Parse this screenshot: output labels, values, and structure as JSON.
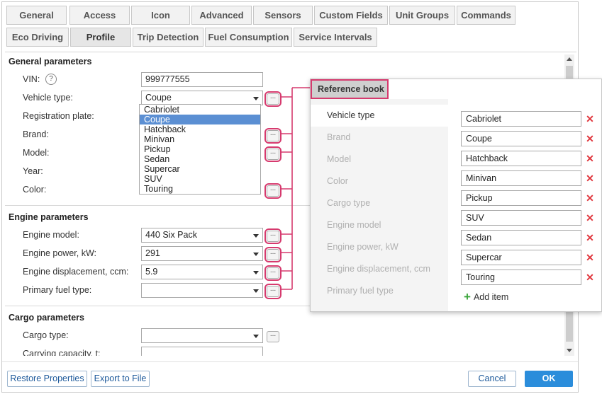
{
  "tabs_row1": [
    "General",
    "Access",
    "Icon",
    "Advanced",
    "Sensors",
    "Custom Fields",
    "Unit Groups",
    "Commands"
  ],
  "tabs_row2": [
    "Eco Driving",
    "Profile",
    "Trip Detection",
    "Fuel Consumption",
    "Service Intervals"
  ],
  "active_tab": "Profile",
  "general": {
    "title": "General parameters",
    "vin_label": "VIN:",
    "vin_value": "999777555",
    "vehicle_type_label": "Vehicle type:",
    "vehicle_type_value": "Coupe",
    "registration_label": "Registration plate:",
    "brand_label": "Brand:",
    "model_label": "Model:",
    "year_label": "Year:",
    "color_label": "Color:"
  },
  "dropdown_options": [
    "Cabriolet",
    "Coupe",
    "Hatchback",
    "Minivan",
    "Pickup",
    "Sedan",
    "Supercar",
    "SUV",
    "Touring"
  ],
  "dropdown_selected": "Coupe",
  "engine": {
    "title": "Engine parameters",
    "model_label": "Engine model:",
    "model_value": "440 Six Pack",
    "power_label": "Engine power, kW:",
    "power_value": "291",
    "displacement_label": "Engine displacement, ccm:",
    "displacement_value": "5.9",
    "fuel_label": "Primary fuel type:",
    "fuel_value": ""
  },
  "cargo": {
    "title": "Cargo parameters",
    "type_label": "Cargo type:",
    "type_value": "",
    "capacity_label": "Carrying capacity, t:",
    "capacity_value": ""
  },
  "footer": {
    "restore": "Restore Properties",
    "export": "Export to File",
    "cancel": "Cancel",
    "ok": "OK"
  },
  "reference_book": {
    "title": "Reference book",
    "categories": [
      "Vehicle type",
      "Brand",
      "Model",
      "Color",
      "Cargo type",
      "Engine model",
      "Engine power, kW",
      "Engine displacement, ccm",
      "Primary fuel type"
    ],
    "active_category": "Vehicle type",
    "items": [
      "Cabriolet",
      "Coupe",
      "Hatchback",
      "Minivan",
      "Pickup",
      "SUV",
      "Sedan",
      "Supercar",
      "Touring"
    ],
    "add_label": "Add item"
  },
  "colors": {
    "highlight": "#d63a6e",
    "primary": "#2b8ddb",
    "selection": "#5b8fd3",
    "delete": "#e0353c",
    "add": "#3aa53a"
  },
  "icons": [
    "help-icon",
    "dropdown-arrow-icon",
    "ellipsis-icon",
    "delete-icon",
    "plus-icon"
  ]
}
